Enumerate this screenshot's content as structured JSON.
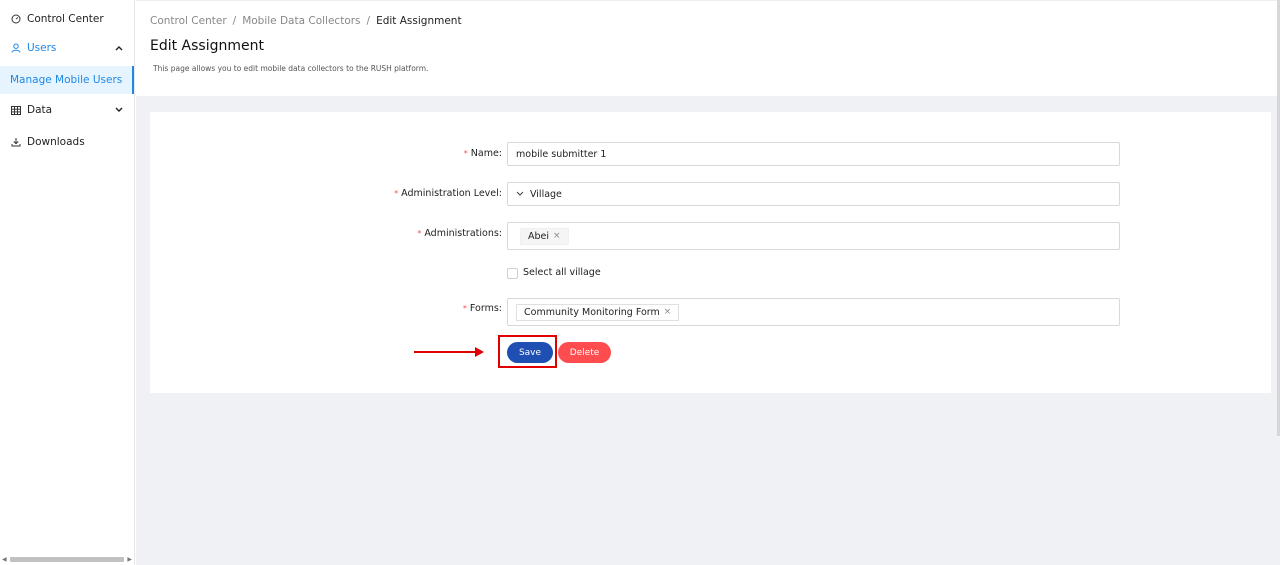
{
  "sidebar": {
    "items": [
      {
        "label": "Control Center",
        "icon": "dashboard-icon"
      },
      {
        "label": "Users",
        "icon": "user-icon",
        "expanded": true
      },
      {
        "label": "Manage Mobile Users",
        "active": true
      },
      {
        "label": "Data",
        "icon": "table-icon",
        "expanded": false
      },
      {
        "label": "Downloads",
        "icon": "download-icon"
      }
    ]
  },
  "breadcrumb": {
    "items": [
      "Control Center",
      "Mobile Data Collectors",
      "Edit Assignment"
    ],
    "separator": "/"
  },
  "page": {
    "title": "Edit Assignment",
    "description": "This page allows you to edit mobile data collectors to the RUSH platform."
  },
  "form": {
    "name": {
      "label": "Name",
      "value": "mobile submitter 1",
      "required": true
    },
    "administration_level": {
      "label": "Administration Level",
      "value": "Village",
      "required": true
    },
    "administrations": {
      "label": "Administrations",
      "tags": [
        "Abei"
      ],
      "required": true
    },
    "select_all": {
      "label": "Select all village",
      "checked": false
    },
    "forms": {
      "label": "Forms",
      "tags": [
        "Community Monitoring Form"
      ],
      "required": true
    },
    "label_suffix": ":",
    "required_mark": "*",
    "tag_close": "×"
  },
  "buttons": {
    "save": "Save",
    "delete": "Delete"
  },
  "colors": {
    "accent": "#1e88e5",
    "save_button": "#1f4fb3",
    "delete_button": "#ff4d4f",
    "highlight": "#e00000",
    "background": "#f0f1f4"
  }
}
